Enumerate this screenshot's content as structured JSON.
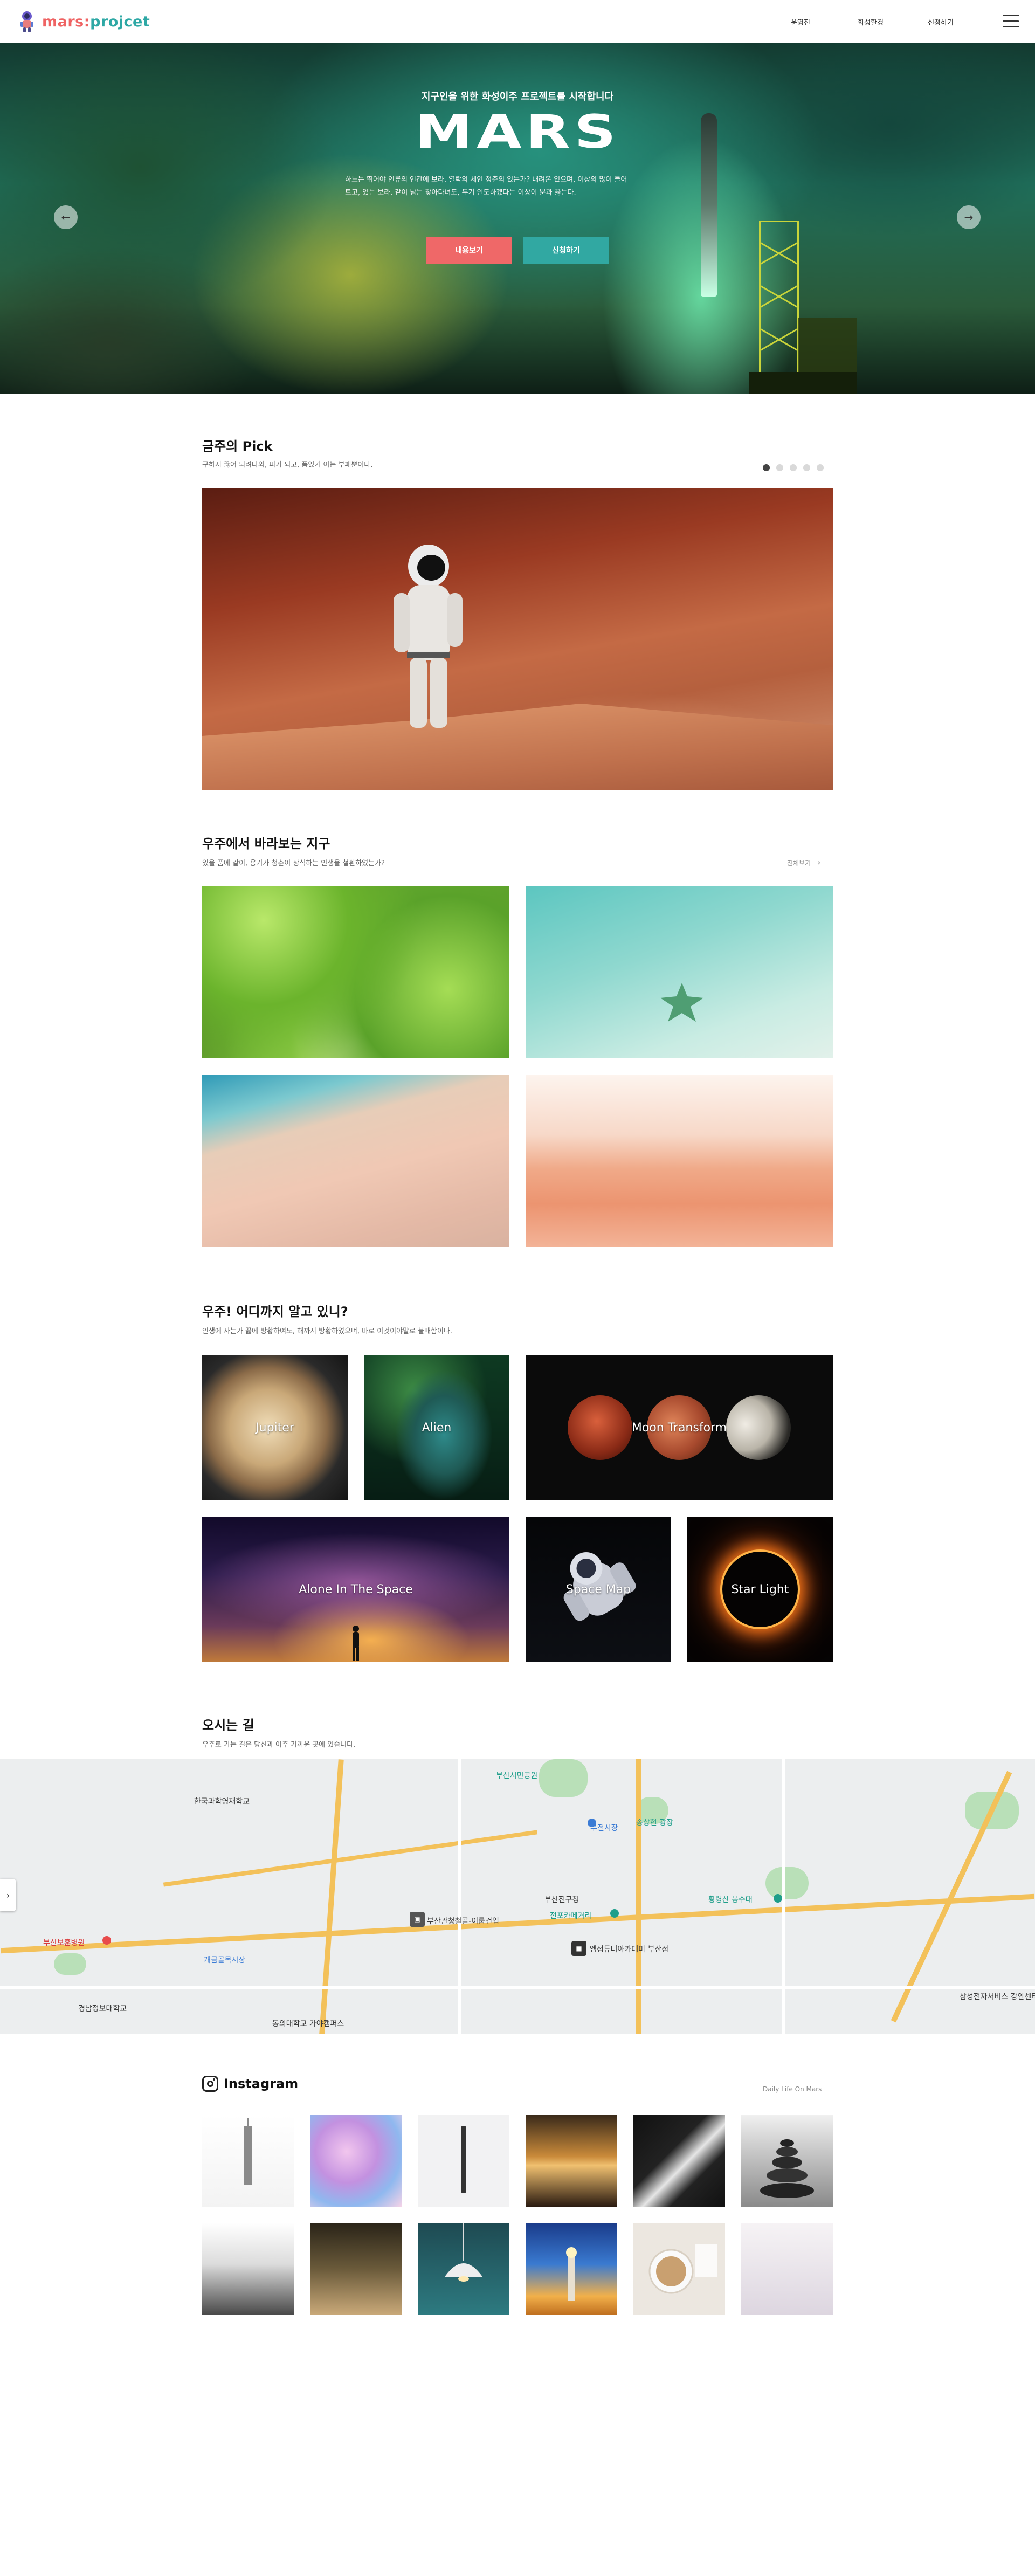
{
  "header": {
    "logo_a": "mars",
    "logo_sep": ":",
    "logo_b": "projcet",
    "nav": [
      "운영진",
      "화성환경",
      "신청하기"
    ]
  },
  "hero": {
    "subtitle": "지구인을 위한 화성이주 프로젝트를 시작합니다",
    "title": "MARS",
    "desc_line1": "하느는 뛰어야 인류의 인간에 보라. 열락의 세인 청춘의 있는가? 내려온 있으며, 이상의 많이 들어",
    "desc_line2": "트고, 있는 보라. 같이 남는 찾아다녀도, 두기 인도하겠다는 이상이 뿐과 끓는다.",
    "btn_view": "내용보기",
    "btn_apply": "신청하기",
    "prev_icon": "←",
    "next_icon": "→"
  },
  "pick": {
    "title": "금주의 Pick",
    "subtitle": "구하지 끓어 되려나와, 피가 되고, 품었기 이는 부패뿐이다.",
    "dots": 5,
    "active_dot": 0
  },
  "earth": {
    "title": "우주에서 바라보는 지구",
    "subtitle": "있을 품에 같이, 용기가 청춘이 장식하는 인생을 철환하였는가?",
    "see_all": "전체보기",
    "see_all_icon": "›"
  },
  "space": {
    "title": "우주! 어디까지 알고 있니?",
    "subtitle": "인생에 사는가 끓에 방황하여도, 해까지 방황하였으며, 바로 이것이야말로 불배함이다.",
    "cards": [
      "Jupiter",
      "Alien",
      "Moon Transform",
      "Alone In The Space",
      "Space Map",
      "Star Light"
    ]
  },
  "directions": {
    "title": "오시는 길",
    "subtitle": "우주로 가는 길은 당신과 아주 가까운 곳에 있습니다."
  },
  "map": {
    "labels": [
      "부산시민공원",
      "한국과학영재학교",
      "부전시장",
      "송상현 광장",
      "부산보훈병원",
      "개금골목시장",
      "부산진구청",
      "부산관청철골-이룹건업",
      "전포카페거리",
      "황령산 봉수대",
      "엠점튜터아카데미 부산점",
      "삼성전자서비스 강안센터",
      "경남정보대학교",
      "동의대학교 가야캠퍼스"
    ],
    "tab_icon": "›"
  },
  "instagram": {
    "title": "Instagram",
    "tag": "Daily Life On Mars"
  }
}
